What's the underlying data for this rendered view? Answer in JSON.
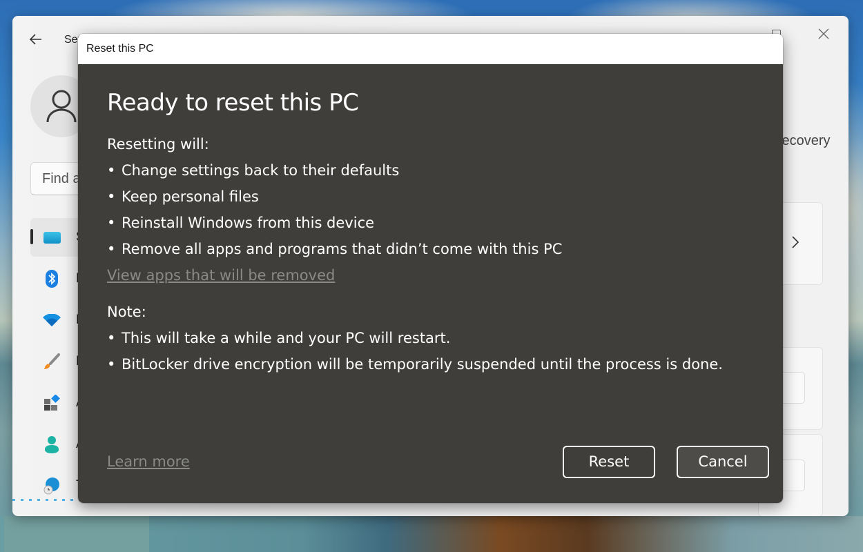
{
  "settings_window": {
    "app_title": "Settings",
    "search_placeholder": "Find a setting",
    "breadcrumb_tail": "Recovery",
    "nav_items": [
      {
        "label": "System",
        "icon": "monitor-icon",
        "selected": true
      },
      {
        "label": "Bluetooth & devices",
        "icon": "bluetooth-icon",
        "selected": false
      },
      {
        "label": "Network & internet",
        "icon": "wifi-icon",
        "selected": false
      },
      {
        "label": "Personalization",
        "icon": "paintbrush-icon",
        "selected": false
      },
      {
        "label": "Apps",
        "icon": "apps-icon",
        "selected": false
      },
      {
        "label": "Accounts",
        "icon": "person-icon",
        "selected": false
      },
      {
        "label": "Time & language",
        "icon": "globe-clock-icon",
        "selected": false
      }
    ]
  },
  "dialog": {
    "title": "Reset this PC",
    "heading": "Ready to reset this PC",
    "resetting_label": "Resetting will:",
    "resetting_items": [
      "Change settings back to their defaults",
      "Keep personal files",
      "Reinstall Windows from this device",
      "Remove all apps and programs that didn’t come with this PC"
    ],
    "view_apps_link": "View apps that will be removed",
    "note_label": "Note:",
    "note_items": [
      "This will take a while and your PC will restart.",
      "BitLocker drive encryption will be temporarily suspended until the process is done."
    ],
    "learn_more_link": "Learn more",
    "reset_button": "Reset",
    "cancel_button": "Cancel",
    "bullet": "•"
  }
}
